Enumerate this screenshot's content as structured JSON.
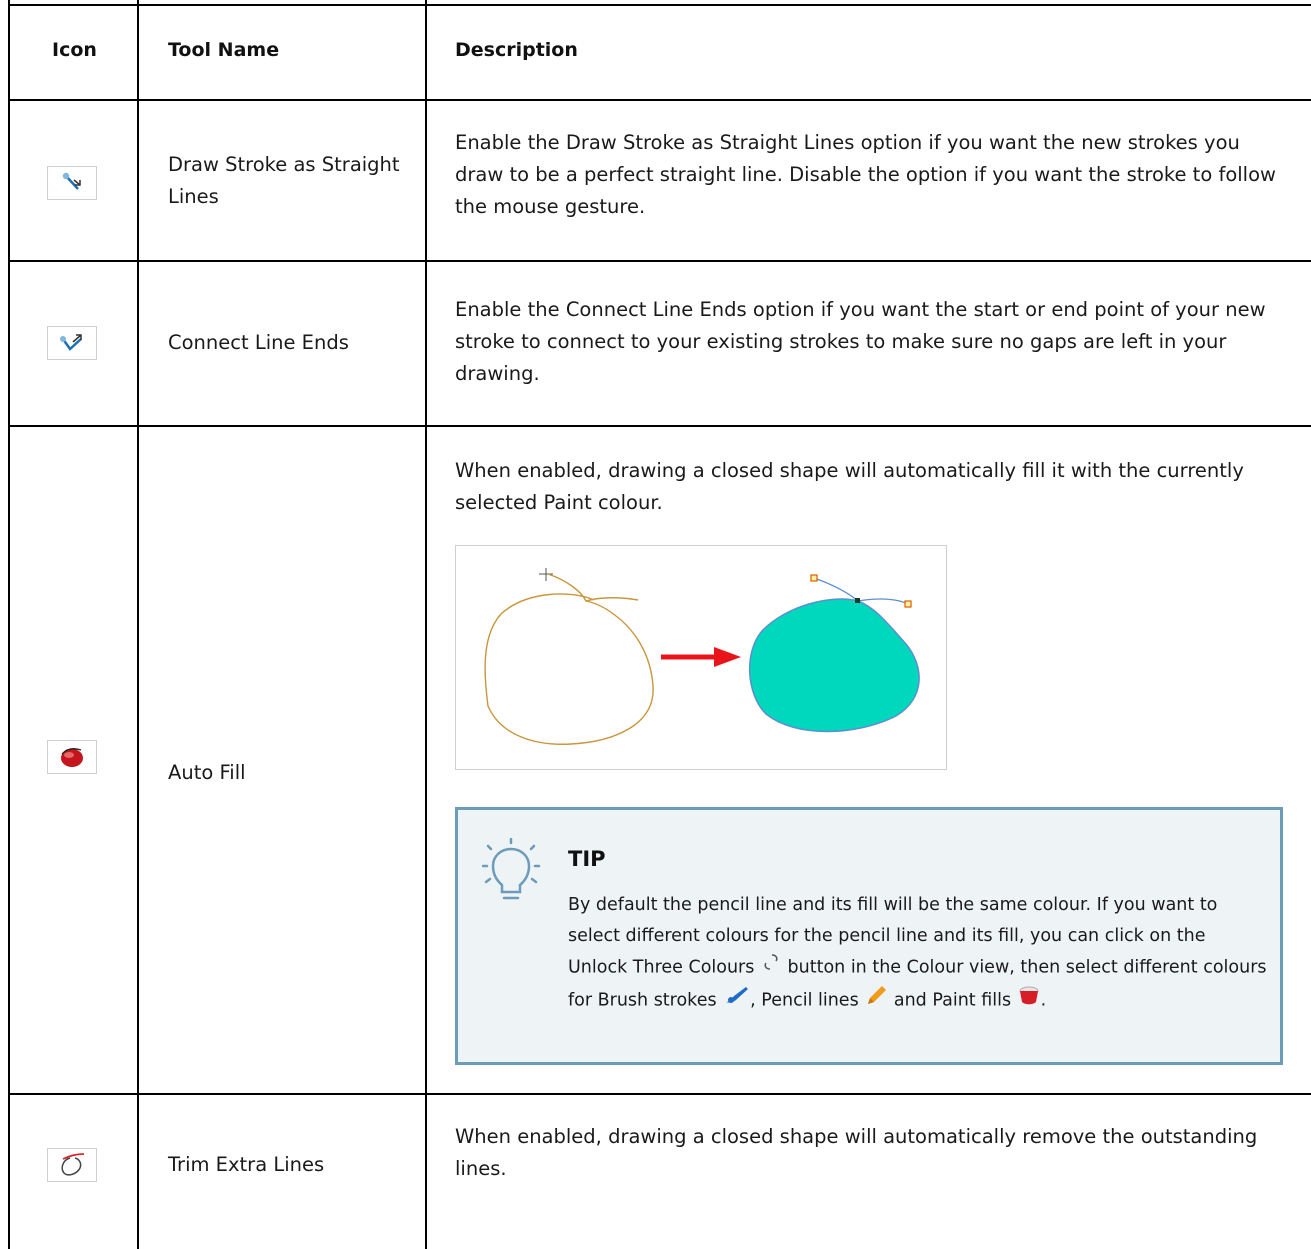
{
  "table": {
    "headers": {
      "icon": "Icon",
      "tool_name": "Tool Name",
      "description": "Description"
    },
    "rows": [
      {
        "icon": "draw-straight-lines-icon",
        "name": "Draw Stroke as Straight Lines",
        "description": "Enable the Draw Stroke as Straight Lines option if you want the new strokes you draw to be a perfect straight line. Disable the option if you want the stroke to follow the mouse gesture."
      },
      {
        "icon": "connect-line-ends-icon",
        "name": "Connect Line Ends",
        "description": "Enable the Connect Line Ends option if you want the start or end point of your new stroke to connect to your existing strokes to make sure no gaps are left in your drawing."
      },
      {
        "icon": "auto-fill-icon",
        "name": "Auto Fill",
        "description": "When enabled, drawing a closed shape will automatically fill it with the currently selected Paint colour."
      },
      {
        "icon": "trim-extra-lines-icon",
        "name": "Trim Extra Lines",
        "description": "When enabled, drawing a closed shape will automatically remove the outstanding lines."
      }
    ]
  },
  "tip": {
    "title": "TIP",
    "text_1": "By default the pencil line and its fill will be the same colour. If you want to select different colours for the pencil line and its fill, you can click on the Unlock Three Colours",
    "text_2": "button in the Colour view, then select different colours for Brush strokes",
    "text_3": ", Pencil lines",
    "text_4": "and Paint fills",
    "text_5": "."
  },
  "colors": {
    "fill_teal": "#00d8bd",
    "pencil_line": "#c8963c",
    "arrow_red": "#e8141a",
    "tip_border": "#6c9bbb",
    "tip_bg": "#eef3f6"
  }
}
